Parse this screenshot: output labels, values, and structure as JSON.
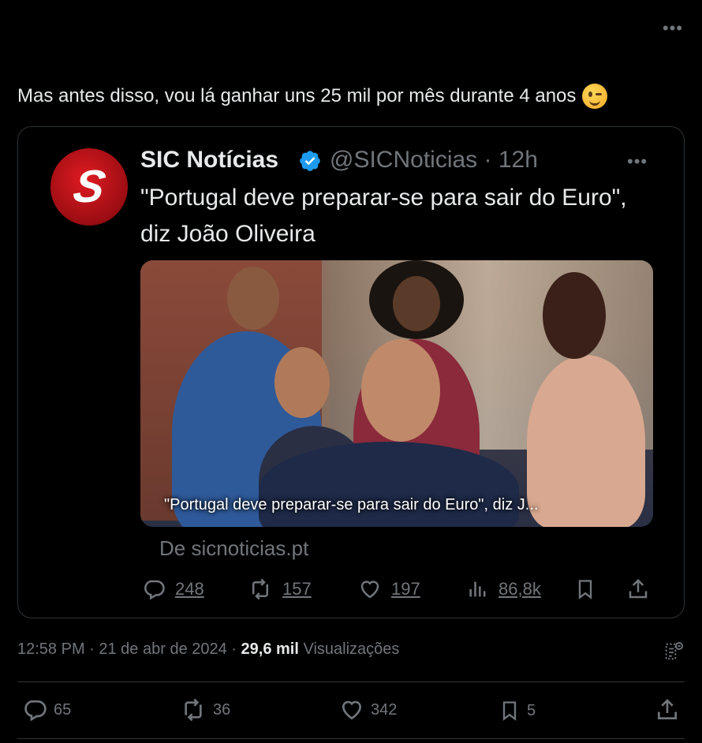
{
  "tweet": {
    "text": "Mas antes disso, vou lá ganhar uns 25 mil por mês durante 4 anos",
    "emoji": "winking-face",
    "timestamp": "12:58 PM · 21 de abr de 2024 · ",
    "views_count": "29,6 mil",
    "views_label": " Visualizações",
    "replies": "65",
    "reposts": "36",
    "likes": "342",
    "bookmarks": "5"
  },
  "quoted": {
    "name": "SIC Notícias",
    "handle": "@SICNoticias · 12h",
    "text": "\"Portugal deve preparar-se para sair do Euro\", diz João Oliveira",
    "avatar_letter": "S",
    "media_caption": "\"Portugal deve preparar-se para sair do Euro\", diz J...",
    "link_domain": "De sicnoticias.pt",
    "replies": "248",
    "reposts": "157",
    "likes": "197",
    "views": "86,8k"
  },
  "colors": {
    "background": "#000000",
    "text": "#e7e9ea",
    "muted": "#71767b",
    "border": "#2f3336",
    "verified": "#1d9bf0",
    "brand_red": "#e01b22"
  }
}
